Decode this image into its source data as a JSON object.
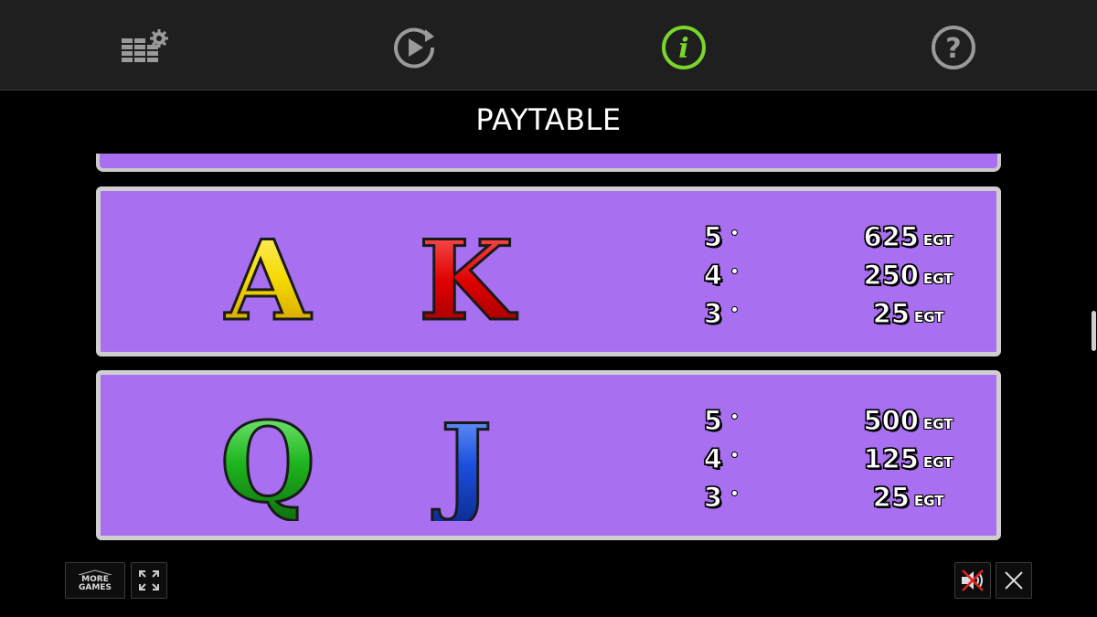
{
  "toolbar": {
    "icons": [
      "settings-icon",
      "autoplay-icon",
      "info-icon",
      "help-icon"
    ],
    "active": "info-icon",
    "info_glyph": "i",
    "help_glyph": "?"
  },
  "title": "PAYTABLE",
  "colors": {
    "panel_bg": "#a86ff0",
    "panel_border": "#cfcfcf",
    "active_icon": "#7bd62b",
    "inactive_icon": "#9a9a9a"
  },
  "paytable": [
    {
      "symbols": [
        "A",
        "K"
      ],
      "rows": [
        {
          "count": "5",
          "amount": "625",
          "unit": "EGT"
        },
        {
          "count": "4",
          "amount": "250",
          "unit": "EGT"
        },
        {
          "count": "3",
          "amount": "25",
          "unit": "EGT"
        }
      ]
    },
    {
      "symbols": [
        "Q",
        "J"
      ],
      "rows": [
        {
          "count": "5",
          "amount": "500",
          "unit": "EGT"
        },
        {
          "count": "4",
          "amount": "125",
          "unit": "EGT"
        },
        {
          "count": "3",
          "amount": "25",
          "unit": "EGT"
        }
      ]
    }
  ],
  "bottom": {
    "more_games_line1": "MORE",
    "more_games_line2": "GAMES",
    "fullscreen_icon": "fullscreen-icon",
    "sound_icon": "sound-muted-icon",
    "close_icon": "close-icon"
  }
}
